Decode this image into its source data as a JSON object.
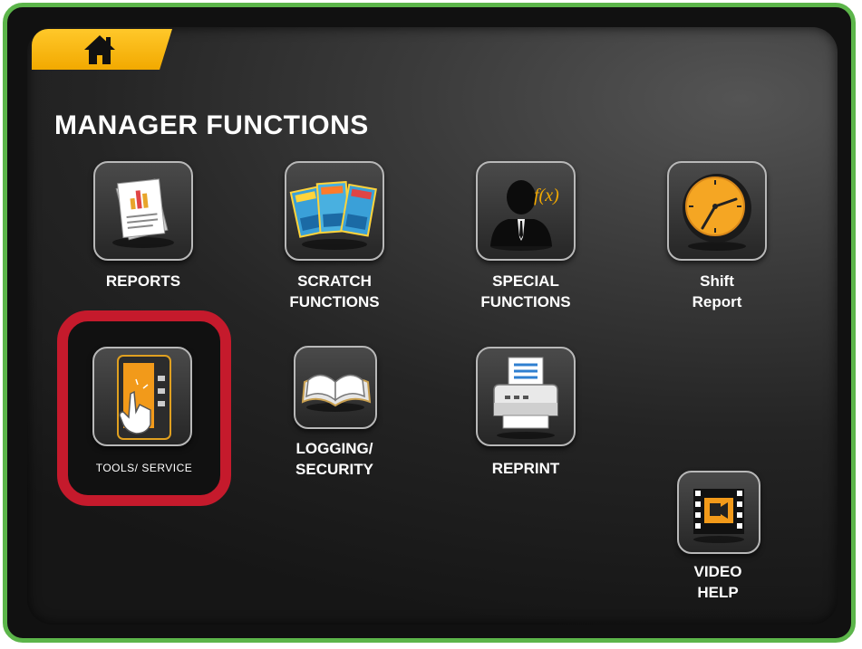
{
  "header": {
    "home_icon": "home-icon",
    "title": "MANAGER FUNCTIONS"
  },
  "tiles": [
    {
      "id": "reports",
      "icon": "reports-icon",
      "label_lines": [
        "REPORTS",
        ""
      ]
    },
    {
      "id": "scratch-functions",
      "icon": "scratch-tickets-icon",
      "label_lines": [
        "SCRATCH",
        "FUNCTIONS"
      ]
    },
    {
      "id": "special-functions",
      "icon": "businessman-function-icon",
      "label_lines": [
        "SPECIAL",
        "FUNCTIONS"
      ]
    },
    {
      "id": "shift-report",
      "icon": "clock-icon",
      "label_lines": [
        "Shift",
        "Report"
      ]
    },
    {
      "id": "tools-service",
      "icon": "touch-terminal-icon",
      "label_lines": [
        "TOOLS/ SERVICE",
        ""
      ],
      "highlighted": true
    },
    {
      "id": "logging-security",
      "icon": "open-book-icon",
      "label_lines": [
        "LOGGING/",
        "SECURITY"
      ]
    },
    {
      "id": "reprint",
      "icon": "printer-icon",
      "label_lines": [
        "REPRINT",
        ""
      ]
    },
    {
      "id": "video-help",
      "icon": "video-film-icon",
      "label_lines": [
        "VIDEO",
        "HELP"
      ]
    }
  ],
  "colors": {
    "frame": "#5cb54a",
    "home_tab": "#f2a900",
    "highlight": "#c51a2c"
  }
}
